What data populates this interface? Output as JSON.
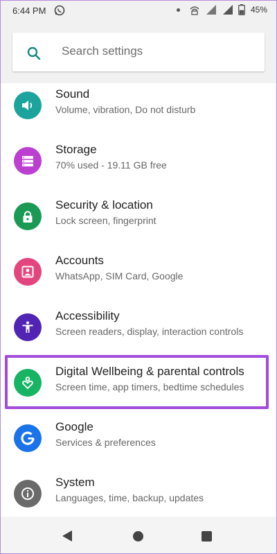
{
  "status_bar": {
    "time": "6:44 PM",
    "battery": "45%",
    "icons": [
      "whatsapp-icon",
      "dot-icon",
      "hotspot-icon",
      "signal-icon",
      "battery-icon"
    ]
  },
  "search": {
    "placeholder": "Search settings"
  },
  "colors": {
    "sound": "#1ba39c",
    "storage": "#bb3fd1",
    "security": "#1a9a55",
    "accounts": "#e3457e",
    "accessibility": "#5224b3",
    "wellbeing": "#16b463",
    "google": "#1a73e8",
    "system": "#6a6a6a",
    "highlight": "#a34bdc"
  },
  "settings": [
    {
      "title": "Sound",
      "subtitle": "Volume, vibration, Do not disturb",
      "icon": "speaker-icon"
    },
    {
      "title": "Storage",
      "subtitle": "70% used - 19.11 GB free",
      "icon": "storage-icon"
    },
    {
      "title": "Security & location",
      "subtitle": "Lock screen, fingerprint",
      "icon": "lock-icon"
    },
    {
      "title": "Accounts",
      "subtitle": "WhatsApp, SIM Card, Google",
      "icon": "account-icon"
    },
    {
      "title": "Accessibility",
      "subtitle": "Screen readers, display, interaction controls",
      "icon": "accessibility-icon"
    },
    {
      "title": "Digital Wellbeing & parental controls",
      "subtitle": "Screen time, app timers, bedtime schedules",
      "icon": "wellbeing-icon"
    },
    {
      "title": "Google",
      "subtitle": "Services & preferences",
      "icon": "google-icon"
    },
    {
      "title": "System",
      "subtitle": "Languages, time, backup, updates",
      "icon": "info-icon"
    }
  ],
  "nav_bar": {
    "icons": [
      "back-icon",
      "home-icon",
      "recents-icon"
    ]
  }
}
